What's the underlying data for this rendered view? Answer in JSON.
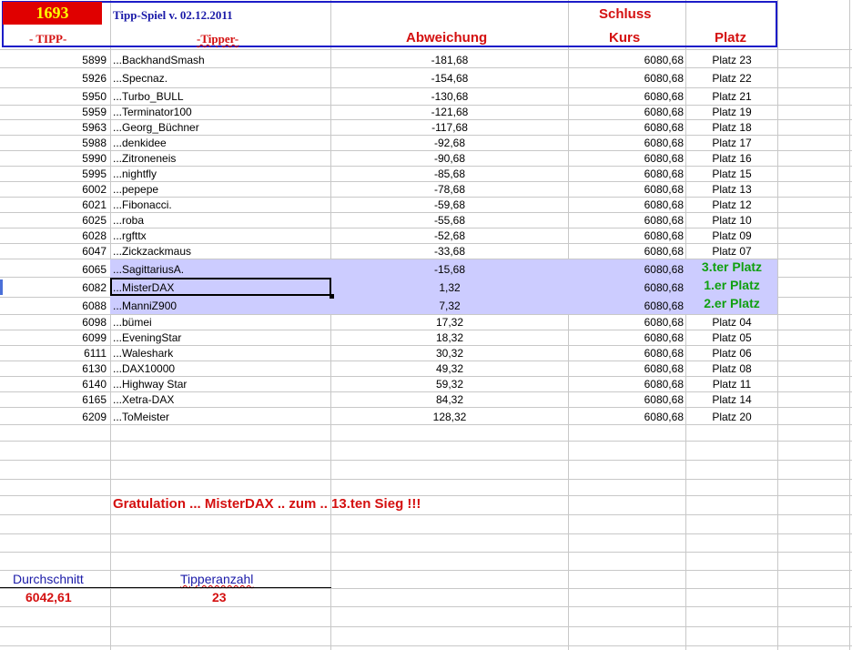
{
  "header": {
    "badge": "1693",
    "title": "Tipp-Spiel v. 02.12.2011",
    "col_tipp": "- TIPP-",
    "col_tipper": "-Tipper-",
    "col_abweichung": "Abweichung",
    "col_schluss": "Schluss",
    "col_kurs": "Kurs",
    "col_platz": "Platz"
  },
  "rows": [
    {
      "tipp": "5899",
      "tipper": "...BackhandSmash",
      "abw": "-181,68",
      "kurs": "6080,68",
      "platz": "Platz 23",
      "special": false
    },
    {
      "tipp": "5926",
      "tipper": "...Specnaz.",
      "abw": "-154,68",
      "kurs": "6080,68",
      "platz": "Platz 22",
      "special": false
    },
    {
      "tipp": "5950",
      "tipper": "...Turbo_BULL",
      "abw": "-130,68",
      "kurs": "6080,68",
      "platz": "Platz 21",
      "special": false
    },
    {
      "tipp": "5959",
      "tipper": "...Terminator100",
      "abw": "-121,68",
      "kurs": "6080,68",
      "platz": "Platz 19",
      "special": false
    },
    {
      "tipp": "5963",
      "tipper": "...Georg_Büchner",
      "abw": "-117,68",
      "kurs": "6080,68",
      "platz": "Platz 18",
      "special": false
    },
    {
      "tipp": "5988",
      "tipper": "...denkidee",
      "abw": "-92,68",
      "kurs": "6080,68",
      "platz": "Platz 17",
      "special": false
    },
    {
      "tipp": "5990",
      "tipper": "...Zitroneneis",
      "abw": "-90,68",
      "kurs": "6080,68",
      "platz": "Platz 16",
      "special": false
    },
    {
      "tipp": "5995",
      "tipper": "...nightfly",
      "abw": "-85,68",
      "kurs": "6080,68",
      "platz": "Platz 15",
      "special": false
    },
    {
      "tipp": "6002",
      "tipper": "...pepepe",
      "abw": "-78,68",
      "kurs": "6080,68",
      "platz": "Platz 13",
      "special": false
    },
    {
      "tipp": "6021",
      "tipper": "...Fibonacci.",
      "abw": "-59,68",
      "kurs": "6080,68",
      "platz": "Platz 12",
      "special": false
    },
    {
      "tipp": "6025",
      "tipper": "...roba",
      "abw": "-55,68",
      "kurs": "6080,68",
      "platz": "Platz 10",
      "special": false
    },
    {
      "tipp": "6028",
      "tipper": "...rgfttx",
      "abw": "-52,68",
      "kurs": "6080,68",
      "platz": "Platz 09",
      "special": false
    },
    {
      "tipp": "6047",
      "tipper": "...Zickzackmaus",
      "abw": "-33,68",
      "kurs": "6080,68",
      "platz": "Platz 07",
      "special": false
    },
    {
      "tipp": "6065",
      "tipper": "...SagittariusA.",
      "abw": "-15,68",
      "kurs": "6080,68",
      "platz": "3.ter Platz",
      "special": true
    },
    {
      "tipp": "6082",
      "tipper": "...MisterDAX",
      "abw": "1,32",
      "kurs": "6080,68",
      "platz": "1.er Platz",
      "special": true
    },
    {
      "tipp": "6088",
      "tipper": "...ManniZ900",
      "abw": "7,32",
      "kurs": "6080,68",
      "platz": "2.er Platz",
      "special": true
    },
    {
      "tipp": "6098",
      "tipper": "...bümei",
      "abw": "17,32",
      "kurs": "6080,68",
      "platz": "Platz 04",
      "special": false
    },
    {
      "tipp": "6099",
      "tipper": "...EveningStar",
      "abw": "18,32",
      "kurs": "6080,68",
      "platz": "Platz 05",
      "special": false
    },
    {
      "tipp": "6111",
      "tipper": "...Waleshark",
      "abw": "30,32",
      "kurs": "6080,68",
      "platz": "Platz 06",
      "special": false
    },
    {
      "tipp": "6130",
      "tipper": "...DAX10000",
      "abw": "49,32",
      "kurs": "6080,68",
      "platz": "Platz 08",
      "special": false
    },
    {
      "tipp": "6140",
      "tipper": "...Highway Star",
      "abw": "59,32",
      "kurs": "6080,68",
      "platz": "Platz 11",
      "special": false
    },
    {
      "tipp": "6165",
      "tipper": "...Xetra-DAX",
      "abw": "84,32",
      "kurs": "6080,68",
      "platz": "Platz 14",
      "special": false
    },
    {
      "tipp": "6209",
      "tipper": "...ToMeister",
      "abw": "128,32",
      "kurs": "6080,68",
      "platz": "Platz 20",
      "special": false
    }
  ],
  "congrats": "Gratulation  ... MisterDAX  .. zum  .. 13.ten Sieg !!!",
  "footer": {
    "avg_label": "Durchschnitt",
    "avg_value": "6042,61",
    "count_label": "Tipperanzahl",
    "count_value": "23"
  },
  "colors": {
    "header_border": "#1c1cc8",
    "badge_bg": "#e00000",
    "badge_text": "#ffff00",
    "highlight": "#ccccff",
    "winner_text": "#10a010",
    "red_text": "#d41010"
  }
}
